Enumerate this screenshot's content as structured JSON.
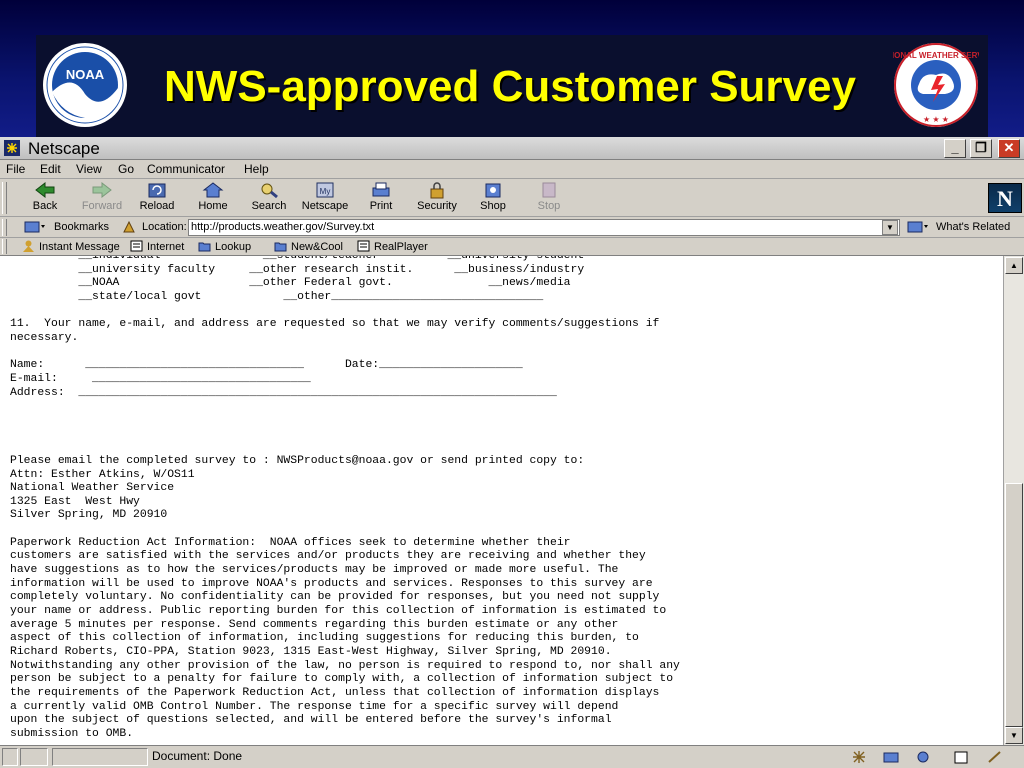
{
  "slide": {
    "title": "NWS-approved Customer Survey",
    "logos": [
      "noaa-logo",
      "national-weather-service-logo"
    ],
    "nws_seal_text": "NATIONAL WEATHER SERVICE",
    "noaa_seal_text": "NOAA"
  },
  "window": {
    "title": "Netscape"
  },
  "menu": [
    "File",
    "Edit",
    "View",
    "Go",
    "Communicator",
    "Help"
  ],
  "toolbar": [
    {
      "label": "Back",
      "icon": "back-arrow-icon",
      "enabled": true
    },
    {
      "label": "Forward",
      "icon": "forward-arrow-icon",
      "enabled": false
    },
    {
      "label": "Reload",
      "icon": "reload-icon",
      "enabled": true
    },
    {
      "label": "Home",
      "icon": "home-icon",
      "enabled": true
    },
    {
      "label": "Search",
      "icon": "search-icon",
      "enabled": true
    },
    {
      "label": "Netscape",
      "icon": "netscape-icon",
      "enabled": true
    },
    {
      "label": "Print",
      "icon": "print-icon",
      "enabled": true
    },
    {
      "label": "Security",
      "icon": "lock-icon",
      "enabled": true
    },
    {
      "label": "Shop",
      "icon": "shop-icon",
      "enabled": true
    },
    {
      "label": "Stop",
      "icon": "stop-icon",
      "enabled": false
    }
  ],
  "location": {
    "bookmarks_label": "Bookmarks",
    "location_label": "Location:",
    "url": "http://products.weather.gov/Survey.txt",
    "whats_related": "What's Related"
  },
  "personal_toolbar": [
    "Instant Message",
    "Internet",
    "Lookup",
    "New&Cool",
    "RealPlayer"
  ],
  "document_lines": [
    "          __individual               __student/teacher          __university student",
    "          __university faculty     __other research instit.      __business/industry",
    "          __NOAA                   __other Federal govt.              __news/media",
    "          __state/local govt            __other_______________________________",
    "",
    "11.  Your name, e-mail, and address are requested so that we may verify comments/suggestions if",
    "necessary.",
    "",
    "Name:      ________________________________      Date:_____________________",
    "E-mail:     ________________________________",
    "Address:  ______________________________________________________________________",
    "",
    "",
    "",
    "",
    "Please email the completed survey to : NWSProducts@noaa.gov or send printed copy to:",
    "Attn: Esther Atkins, W/OS11",
    "National Weather Service",
    "1325 East  West Hwy",
    "Silver Spring, MD 20910",
    "",
    "Paperwork Reduction Act Information:  NOAA offices seek to determine whether their",
    "customers are satisfied with the services and/or products they are receiving and whether they",
    "have suggestions as to how the services/products may be improved or made more useful. The",
    "information will be used to improve NOAA's products and services. Responses to this survey are",
    "completely voluntary. No confidentiality can be provided for responses, but you need not supply",
    "your name or address. Public reporting burden for this collection of information is estimated to",
    "average 5 minutes per response. Send comments regarding this burden estimate or any other",
    "aspect of this collection of information, including suggestions for reducing this burden, to",
    "Richard Roberts, CIO-PPA, Station 9023, 1315 East-West Highway, Silver Spring, MD 20910.",
    "Notwithstanding any other provision of the law, no person is required to respond to, nor shall any",
    "person be subject to a penalty for failure to comply with, a collection of information subject to",
    "the requirements of the Paperwork Reduction Act, unless that collection of information displays",
    "a currently valid OMB Control Number. The response time for a specific survey will depend",
    "upon the subject of questions selected, and will be entered before the survey's informal",
    "submission to OMB."
  ],
  "status": {
    "text": "Document: Done"
  },
  "colors": {
    "title_yellow": "#ffff00",
    "slide_bg": "#0a0f5a",
    "chrome": "#d4d0c8"
  }
}
